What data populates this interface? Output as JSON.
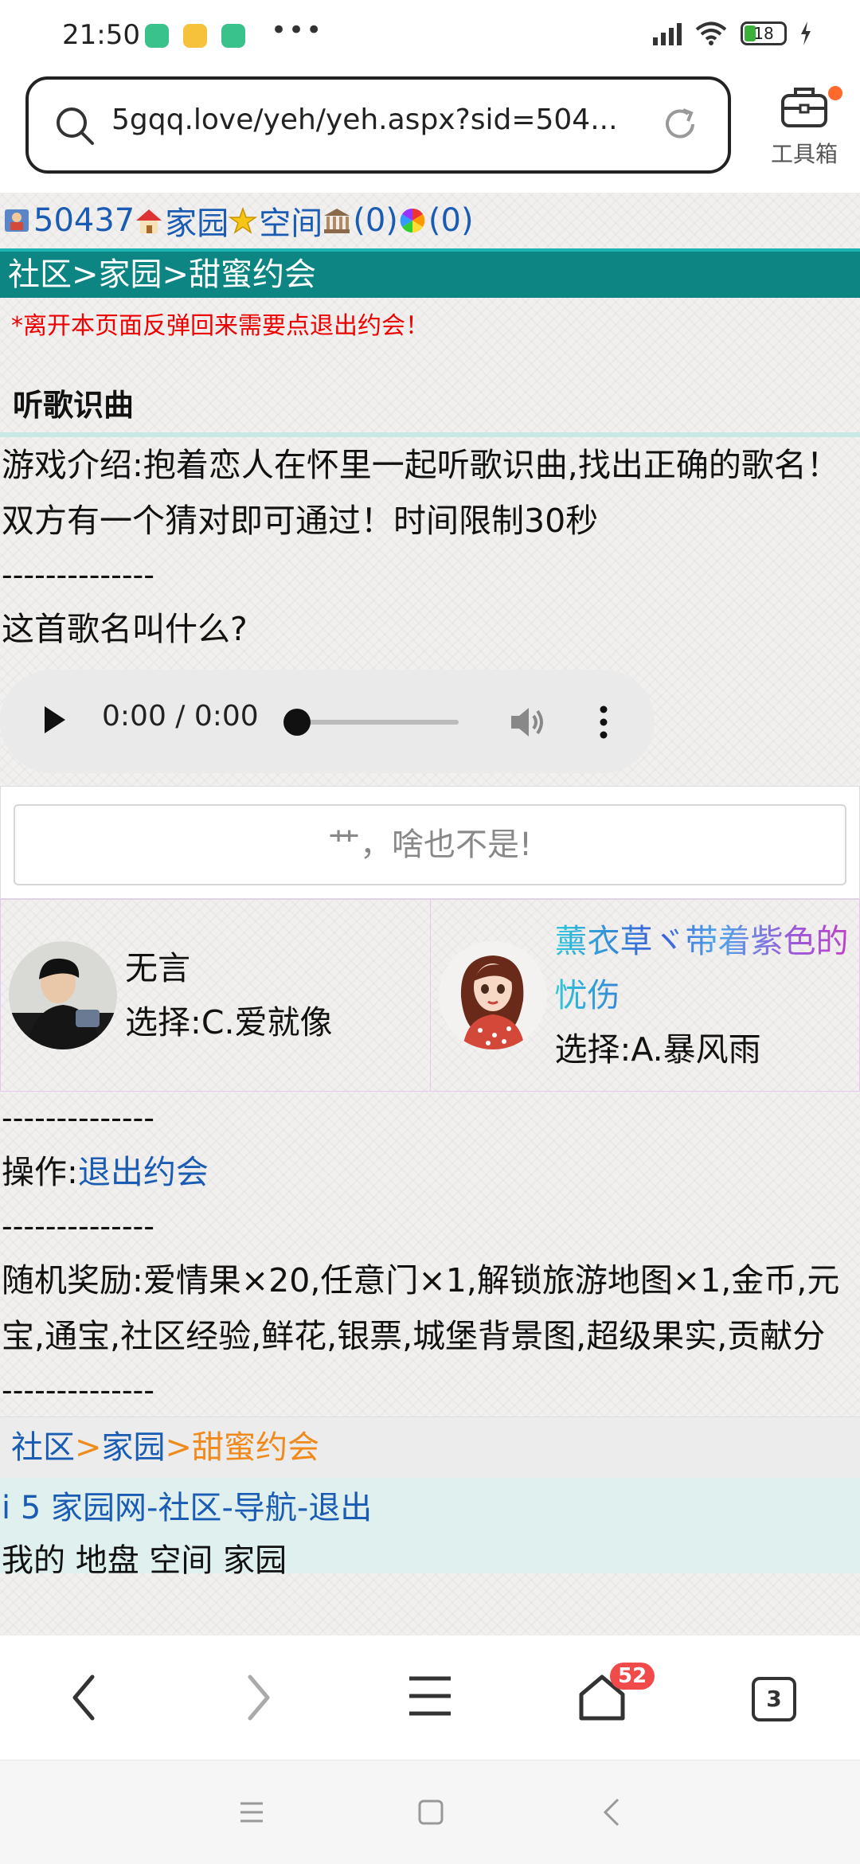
{
  "status": {
    "time": "21:50",
    "battery": "18",
    "dots": "•••"
  },
  "address_bar": {
    "url": "5gqq.love/yeh/yeh.aspx?sid=504...",
    "toolbox_label": "工具箱"
  },
  "top_nav": {
    "user_id": "50437",
    "home": "家园",
    "space": "空间",
    "count1": "(0)",
    "count2": "(0)"
  },
  "breadcrumb_title": "社区>家园>甜蜜约会",
  "notice": "*离开本页面反弹回来需要点退出约会！",
  "game": {
    "title": "听歌识曲",
    "intro": "游戏介绍:抱着恋人在怀里一起听歌识曲,找出正确的歌名！双方有一个猜对即可通过！时间限制30秒",
    "separator": "--------------",
    "question": "这首歌名叫什么?"
  },
  "player": {
    "time": "0:00 / 0:00"
  },
  "answer_box": {
    "text": "艹，啥也不是!"
  },
  "players": [
    {
      "name": "无言",
      "choice": "选择:C.爱就像"
    },
    {
      "name": "薰衣草ヾ带着紫色的忧伤",
      "choice": "选择:A.暴风雨"
    }
  ],
  "operation": {
    "label": "操作:",
    "action": "退出约会"
  },
  "reward": {
    "text": "随机奖励:爱情果×20,任意门×1,解锁旅游地图×1,金币,元宝,通宝,社区经验,鲜花,银票,城堡背景图,超级果实,贡献分"
  },
  "bottom_crumb": {
    "a": "社区",
    "sep": ">",
    "b": "家园",
    "c": "甜蜜约会"
  },
  "footer": {
    "prefix": "i 5 ",
    "site": "家园网",
    "d1": "-",
    "community": "社区",
    "d2": "-",
    "guide": "导航",
    "d3": "-",
    "logout": "退出",
    "line2": "我的 地盘 空间 家园"
  },
  "browser": {
    "notif_count": "52",
    "tab_count": "3"
  },
  "colors": {
    "title_bar": "#0c8583",
    "link": "#1a5cb4",
    "orange": "#f08a1c",
    "notice": "#e00000"
  }
}
